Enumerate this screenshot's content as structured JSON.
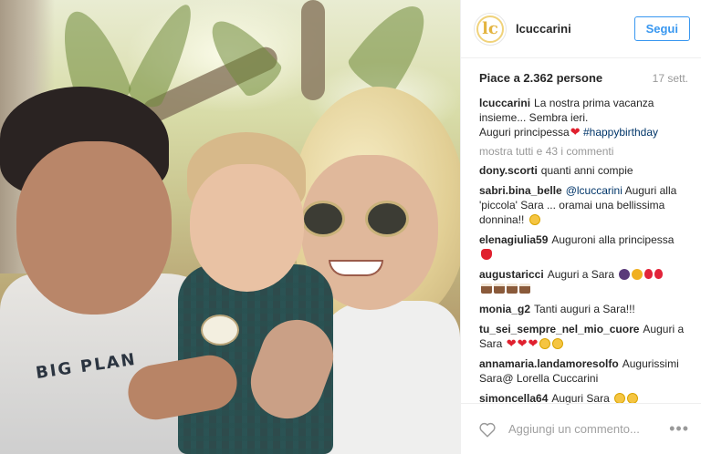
{
  "photo": {
    "shirt_print": "BIG PLAN"
  },
  "header": {
    "avatar_text": "lc",
    "username": "lcuccarini",
    "follow_label": "Segui"
  },
  "stats": {
    "likes": "Piace a 2.362 persone",
    "date": "17 sett."
  },
  "caption": {
    "user": "lcuccarini",
    "text_1": "La nostra prima vacanza insieme... Sembra ieri.",
    "text_2": "Auguri principessa",
    "hashtag": "#happybirthday"
  },
  "view_all": "mostra tutti e 43 i commenti",
  "comments": [
    {
      "user": "dony.scorti",
      "text": "quanti anni compie"
    },
    {
      "user": "sabri.bina_belle",
      "mention": "@lcuccarini",
      "text": "Auguri alla 'piccola' Sara ... oramai una bellissima donnina!!"
    },
    {
      "user": "elenagiulia59",
      "text": "Auguroni alla principessa"
    },
    {
      "user": "augustaricci",
      "text": "Auguri a Sara"
    },
    {
      "user": "monia_g2",
      "text": "Tanti auguri a Sara!!!"
    },
    {
      "user": "tu_sei_sempre_nel_mio_cuore",
      "text": "Auguri a Sara"
    },
    {
      "user": "annamaria.landamoresolfo",
      "text": "Augurissimi Sara@ Lorella Cuccarini"
    },
    {
      "user": "simoncella64",
      "text": "Auguri Sara"
    }
  ],
  "footer": {
    "placeholder": "Aggiungi un commento...",
    "more": "•••"
  },
  "colors": {
    "accent": "#3897f0",
    "avatar_gold": "#e3b440",
    "heart": "#e0202e",
    "muted": "#999999"
  },
  "icons": [
    "heart-outline-icon",
    "more-options-icon"
  ]
}
